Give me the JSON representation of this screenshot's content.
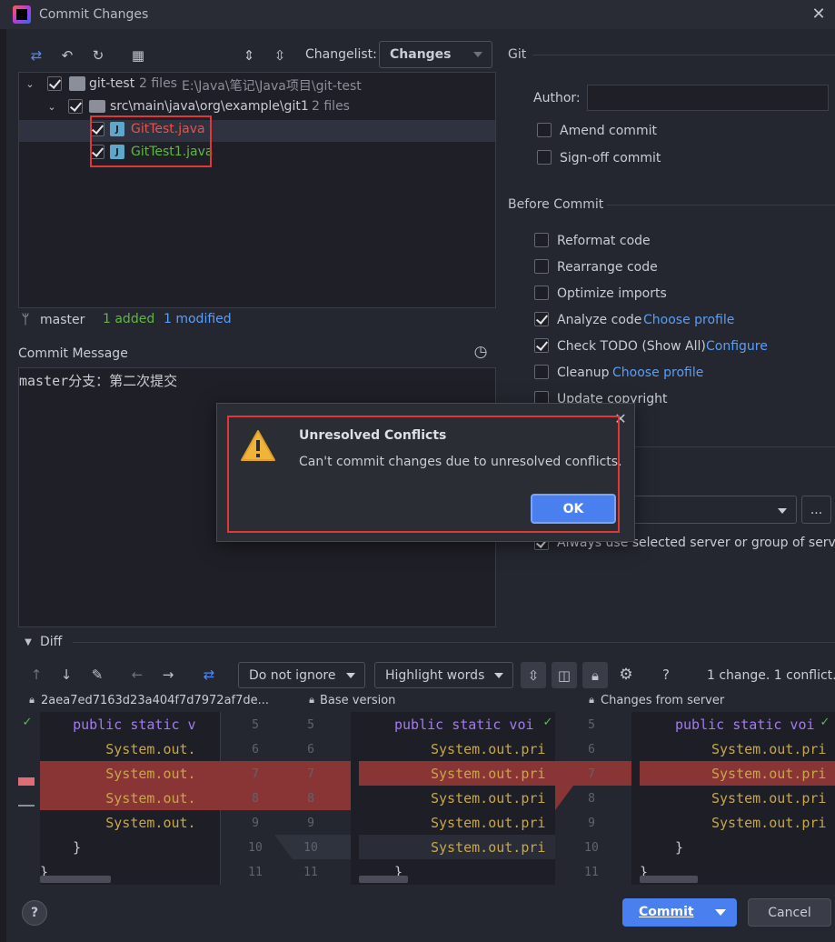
{
  "window": {
    "title": "Commit Changes"
  },
  "toolbar": {
    "changelist_label": "Changelist:",
    "changelist_value": "Changes"
  },
  "tree": {
    "root": {
      "name": "git-test",
      "count": "2 files",
      "path": "E:\\Java\\笔记\\Java项目\\git-test"
    },
    "folder": {
      "name": "src\\main\\java\\org\\example\\git1",
      "count": "2 files"
    },
    "files": [
      {
        "name": "GitTest.java",
        "status": "conflict"
      },
      {
        "name": "GitTest1.java",
        "status": "added"
      }
    ]
  },
  "branch": {
    "name": "master",
    "added": "1 added",
    "modified": "1 modified"
  },
  "commit_message": {
    "label": "Commit Message",
    "text": "master分支：第二次提交"
  },
  "git_panel": {
    "title": "Git",
    "author_label": "Author:",
    "author_value": "",
    "amend": "Amend commit",
    "signoff": "Sign-off commit"
  },
  "before_commit": {
    "title": "Before Commit",
    "items": [
      {
        "label": "Reformat code",
        "checked": false,
        "link": ""
      },
      {
        "label": "Rearrange code",
        "checked": false,
        "link": ""
      },
      {
        "label": "Optimize imports",
        "checked": false,
        "link": ""
      },
      {
        "label": "Analyze code",
        "checked": true,
        "link": "Choose profile"
      },
      {
        "label": "Check TODO (Show All)",
        "checked": true,
        "link": "Configure"
      },
      {
        "label": "Cleanup",
        "checked": false,
        "link": "Choose profile"
      },
      {
        "label": "Update copyright",
        "checked": false,
        "link": ""
      }
    ],
    "always_use": "Always use selected server or group of servers",
    "more_button": "..."
  },
  "dialog": {
    "title": "Unresolved Conflicts",
    "message": "Can't commit changes due to unresolved conflicts.",
    "ok": "OK"
  },
  "diff": {
    "title": "Diff",
    "ignore": "Do not ignore",
    "highlight": "Highlight words",
    "help": "?",
    "summary": "1 change. 1 conflict.",
    "left_title": "2aea7ed7163d23a404f7d7972af7de...",
    "middle_title": "Base version",
    "right_title": "Changes from server",
    "left_lines": [
      {
        "a": "    ",
        "b": "public static v"
      },
      {
        "a": "        ",
        "b": "System.out."
      },
      {
        "a": "        ",
        "b": "System.out."
      },
      {
        "a": "        ",
        "b": "System.out."
      },
      {
        "a": "        ",
        "b": "System.out."
      },
      {
        "a": "    ",
        "b": "}"
      },
      {
        "a": "",
        "b": "}"
      }
    ],
    "mid_lines": [
      "public static voi",
      "System.out.pri",
      "System.out.pri",
      "System.out.pri",
      "System.out.pri",
      "System.out.pri",
      "}"
    ],
    "right_lines": [
      "public static voi",
      "System.out.pri",
      "System.out.pri",
      "System.out.pri",
      "System.out.pri",
      "}",
      "}"
    ],
    "ln_a": [
      "5",
      "6",
      "7",
      "8",
      "9",
      "10",
      "11"
    ],
    "ln_b": [
      "5",
      "6",
      "7",
      "8",
      "9",
      "10",
      "11"
    ],
    "ln_c": [
      "5",
      "6",
      "7",
      "8",
      "9",
      "10",
      "11"
    ]
  },
  "footer": {
    "help": "?",
    "commit": "Commit",
    "cancel": "Cancel"
  },
  "colors": {
    "accent": "#4a7ff0",
    "conflict_red": "#e5534b",
    "added_green": "#62b543",
    "modified_blue": "#5a9ef5",
    "diff_conflict_bg": "#8a3535"
  }
}
